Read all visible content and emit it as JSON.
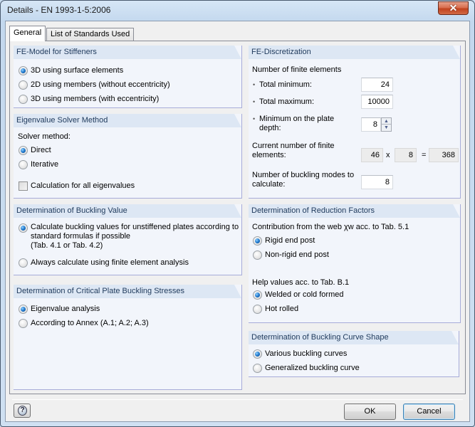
{
  "window": {
    "title": "Details - EN 1993-1-5:2006",
    "close_icon": "close-icon"
  },
  "tabs": [
    {
      "label": "General",
      "active": true
    },
    {
      "label": "List of Standards Used",
      "active": false
    }
  ],
  "fe_model": {
    "title": "FE-Model for Stiffeners",
    "options": [
      {
        "label": "3D using surface elements",
        "selected": true
      },
      {
        "label": "2D using members (without eccentricity)",
        "selected": false
      },
      {
        "label": "3D using members (with eccentricity)",
        "selected": false
      }
    ]
  },
  "eigen_solver": {
    "title": "Eigenvalue Solver Method",
    "solver_label": "Solver method:",
    "options": [
      {
        "label": "Direct",
        "selected": true
      },
      {
        "label": "Iterative",
        "selected": false
      }
    ],
    "all_eigen_label": "Calculation for all eigenvalues",
    "all_eigen_checked": false
  },
  "buckling_value": {
    "title": "Determination of Buckling Value",
    "option1_line1": "Calculate buckling values for unstiffened plates according to",
    "option1_line2": "standard formulas if possible",
    "option1_line3": "(Tab. 4.1 or Tab. 4.2)",
    "option1_selected": true,
    "option2": "Always calculate using finite element analysis",
    "option2_selected": false
  },
  "critical_stress": {
    "title": "Determination of Critical Plate Buckling Stresses",
    "options": [
      {
        "label": "Eigenvalue analysis",
        "selected": true
      },
      {
        "label": "According to Annex (A.1; A.2; A.3)",
        "selected": false
      }
    ]
  },
  "fe_discretization": {
    "title": "FE-Discretization",
    "num_label": "Number of finite elements",
    "bullet": "•",
    "total_min_label": "Total minimum:",
    "total_min_value": "24",
    "total_max_label": "Total maximum:",
    "total_max_value": "10000",
    "min_depth_line1": "Minimum on the plate",
    "min_depth_line2": "depth:",
    "min_depth_value": "8",
    "current_line1": "Current number of finite",
    "current_line2": "elements:",
    "current_a": "46",
    "times": "x",
    "current_b": "8",
    "equals": "=",
    "current_total": "368",
    "modes_line1": "Number of buckling modes to",
    "modes_line2": "calculate:",
    "modes_value": "8"
  },
  "reduction_factors": {
    "title": "Determination of Reduction Factors",
    "contribution_label": "Contribution from the web χw acc. to Tab. 5.1",
    "end_post_options": [
      {
        "label": "Rigid end post",
        "selected": true
      },
      {
        "label": "Non-rigid end post",
        "selected": false
      }
    ],
    "help_label": "Help values acc. to Tab. B.1",
    "help_options": [
      {
        "label": "Welded or cold formed",
        "selected": true
      },
      {
        "label": "Hot rolled",
        "selected": false
      }
    ]
  },
  "curve_shape": {
    "title": "Determination of Buckling Curve Shape",
    "options": [
      {
        "label": "Various buckling curves",
        "selected": true
      },
      {
        "label": "Generalized buckling curve",
        "selected": false
      }
    ]
  },
  "footer": {
    "help_icon": "?",
    "ok_label": "OK",
    "cancel_label": "Cancel"
  }
}
